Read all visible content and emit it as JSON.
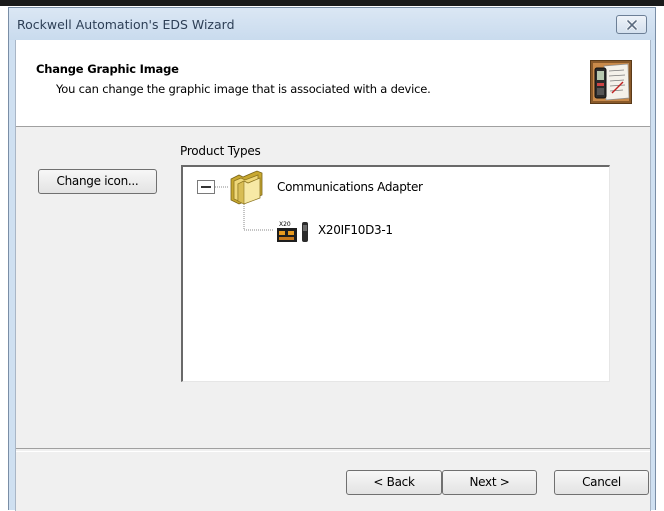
{
  "window": {
    "title": "Rockwell Automation's EDS Wizard",
    "close_icon": "close-icon"
  },
  "header": {
    "title": "Change Graphic Image",
    "subtitle": "You can change the graphic image that is associated with a device.",
    "art_icon": "wizard-device-art-icon"
  },
  "actions": {
    "change_icon_label": "Change icon..."
  },
  "product_types": {
    "label": "Product Types",
    "tree": {
      "root": {
        "label": "Communications Adapter",
        "expanded": true,
        "expander_icon": "collapse-minus-icon",
        "icon": "folder-stack-icon",
        "children": [
          {
            "label": "X20IF10D3-1",
            "icon": "x20-module-icon",
            "badge": "X20"
          }
        ]
      }
    }
  },
  "footer": {
    "back_label": "< Back",
    "next_label": "Next >",
    "cancel_label": "Cancel"
  }
}
